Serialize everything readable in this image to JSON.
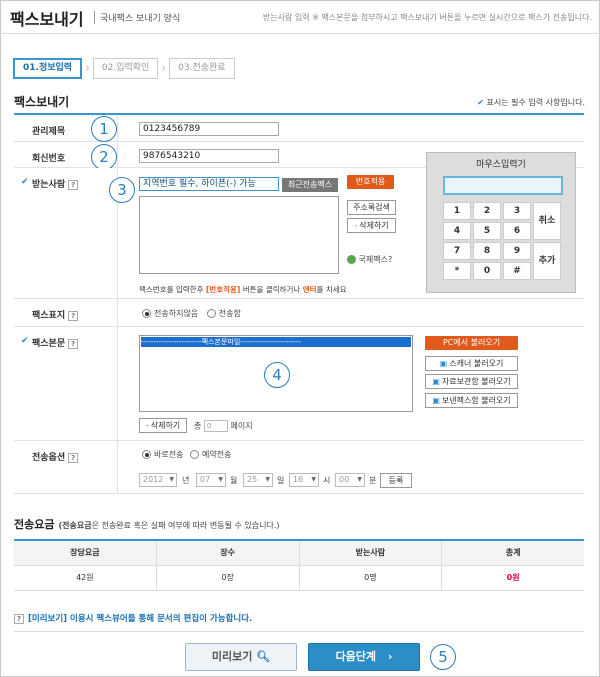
{
  "header": {
    "title": "팩스보내기",
    "subtitle": "국내팩스 보내기 양식",
    "note": "받는사람 입력 ※ 팩스본문을 첨부하시고 팩스보내기 버튼을 누르면 실시간으로 팩스가 전송됩니다."
  },
  "steps": [
    "01.정보입력",
    "02.입력확인",
    "03.전송완료"
  ],
  "section_title": "팩스보내기",
  "required_note": "표시는 필수 입력 사항입니다.",
  "fields": {
    "title": {
      "label": "관리제목",
      "value": "0123456789",
      "marker": "1"
    },
    "reply": {
      "label": "회신번호",
      "value": "9876543210",
      "marker": "2"
    },
    "recipient": {
      "label": "받는사람",
      "marker": "3",
      "placeholder": "지역번호 필수, 하이픈(-) 가능",
      "recent_btn": "최근전송팩스",
      "apply_btn": "번호적용",
      "addr_btn": "주소록검색",
      "delete_btn": "삭제하기",
      "intl_label": "국제팩스?",
      "hint_pre": "팩스번호를 입력한후",
      "hint_btn": "[번호적용]",
      "hint_mid": "버튼을 클릭하거나",
      "hint_enter": "엔터",
      "hint_post": "를 치세요"
    },
    "cover": {
      "label": "팩스표지",
      "opt1": "전송하지않음",
      "opt2": "전송함"
    },
    "body": {
      "label": "팩스본문",
      "marker": "4",
      "selected_item": "------------------------팩스본문파일------------------------",
      "pc_btn": "PC에서 불러오기",
      "scanner_btn": "스캐너 불러오기",
      "storage_btn": "자료보관함 불러오기",
      "sent_btn": "보낸팩스함 불러오기",
      "delete_btn": "삭제하기",
      "total_label": "총",
      "pages_value": "0",
      "pages_label": "페이지"
    },
    "options": {
      "label": "전송옵션",
      "opt1": "바로전송",
      "opt2": "예약전송",
      "year": "2012",
      "year_unit": "년",
      "month": "07",
      "month_unit": "월",
      "day": "25",
      "day_unit": "일",
      "hour": "16",
      "hour_unit": "시",
      "minute": "00",
      "minute_unit": "분",
      "register_btn": "등록"
    }
  },
  "mouse_pad": {
    "title": "마우스입력기",
    "keys": [
      "1",
      "2",
      "3",
      "4",
      "5",
      "6",
      "7",
      "8",
      "9",
      "*",
      "0",
      "#"
    ],
    "cancel": "취소",
    "add": "추가"
  },
  "fees": {
    "title": "전송요금",
    "note_bold": "(전송요금",
    "note_rest": "은 전송완료 혹은 실패 여부에 따라 변동될 수 있습니다.)",
    "headers": [
      "장당요금",
      "장수",
      "받는사람",
      "총계"
    ],
    "values": [
      "42원",
      "0장",
      "0명",
      "0원"
    ]
  },
  "preview_note": "[미리보기] 이용시 팩스뷰어를 통해 문서의 편집이 가능합니다.",
  "buttons": {
    "preview": "미리보기",
    "next": "다음단계",
    "marker": "5"
  },
  "colors": {
    "accent": "#3b95d2",
    "orange": "#e05a1c",
    "total": "#e0004d",
    "next_btn": "#2b8ec6"
  }
}
